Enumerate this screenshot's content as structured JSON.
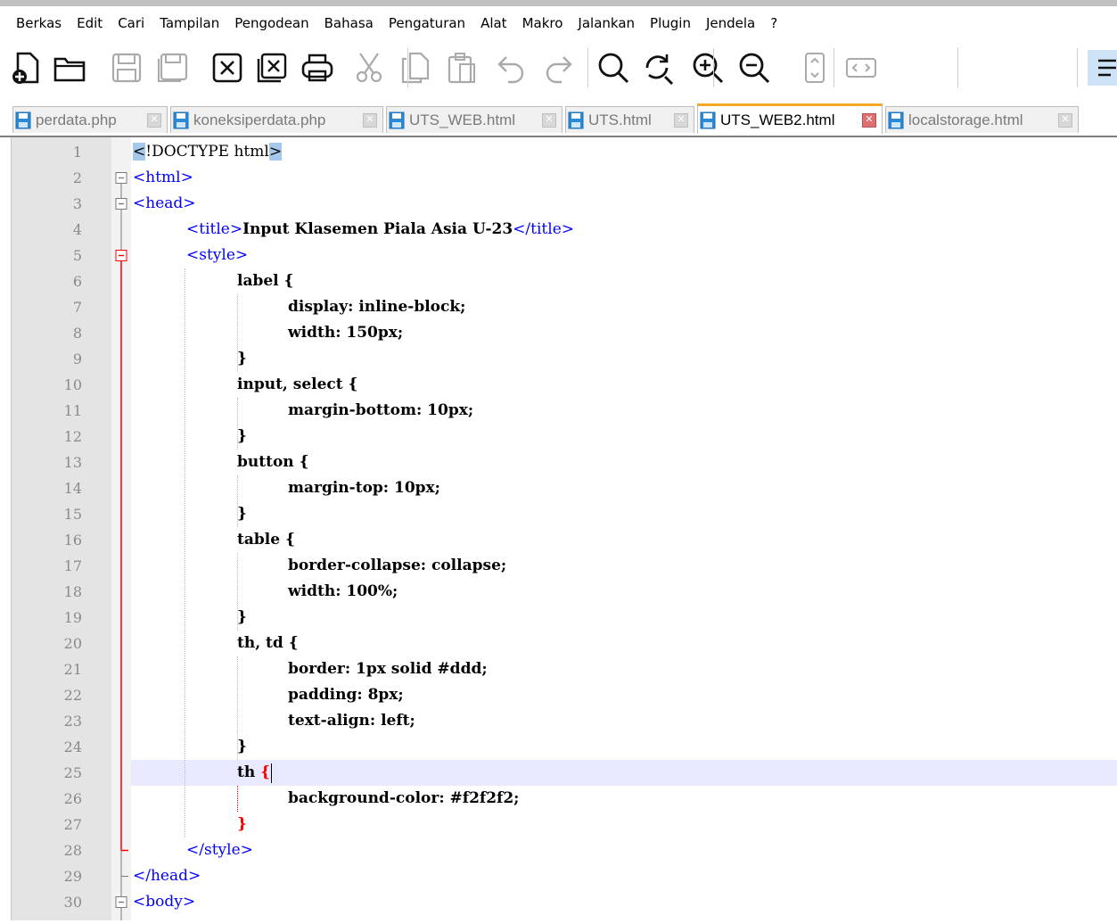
{
  "menu": [
    "Berkas",
    "Edit",
    "Cari",
    "Tampilan",
    "Pengodean",
    "Bahasa",
    "Pengaturan",
    "Alat",
    "Makro",
    "Jalankan",
    "Plugin",
    "Jendela",
    "?"
  ],
  "toolbar": [
    {
      "name": "new-file-icon"
    },
    {
      "name": "open-folder-icon"
    },
    {
      "name": "save-icon"
    },
    {
      "name": "save-all-icon"
    },
    {
      "name": "close-file-icon"
    },
    {
      "name": "close-all-icon"
    },
    {
      "name": "print-icon"
    },
    {
      "name": "cut-icon"
    },
    {
      "name": "copy-icon"
    },
    {
      "name": "paste-icon"
    },
    {
      "name": "undo-icon"
    },
    {
      "name": "redo-icon"
    },
    {
      "name": "find-icon"
    },
    {
      "name": "replace-icon"
    },
    {
      "name": "zoom-in-icon"
    },
    {
      "name": "zoom-out-icon"
    },
    {
      "name": "sync-vertical-icon"
    },
    {
      "name": "sync-horizontal-icon"
    },
    {
      "name": "word-wrap-icon"
    }
  ],
  "tabs": [
    {
      "label": "perdata.php",
      "active": false
    },
    {
      "label": "koneksiperdata.php",
      "active": false
    },
    {
      "label": "UTS_WEB.html",
      "active": false
    },
    {
      "label": "UTS.html",
      "active": false
    },
    {
      "label": "UTS_WEB2.html",
      "active": true
    },
    {
      "label": "localstorage.html",
      "active": false
    }
  ],
  "editor": {
    "current_line": 25,
    "lines": [
      {
        "n": "1",
        "indent": 0,
        "parts": [
          [
            "hl",
            "<"
          ],
          [
            "doc",
            "!DOCTYPE html"
          ],
          [
            "hl",
            ">"
          ]
        ]
      },
      {
        "n": "2",
        "indent": 0,
        "parts": [
          [
            "tag",
            "<html>"
          ]
        ]
      },
      {
        "n": "3",
        "indent": 0,
        "parts": [
          [
            "tag",
            "<head>"
          ]
        ]
      },
      {
        "n": "4",
        "indent": 1,
        "parts": [
          [
            "tag",
            "<title>"
          ],
          [
            "b",
            "Input Klasemen Piala Asia U-23"
          ],
          [
            "tag",
            "</title>"
          ]
        ]
      },
      {
        "n": "5",
        "indent": 1,
        "parts": [
          [
            "tag",
            "<style>"
          ]
        ]
      },
      {
        "n": "6",
        "indent": 2,
        "parts": [
          [
            "b",
            "label {"
          ]
        ]
      },
      {
        "n": "7",
        "indent": 3,
        "parts": [
          [
            "b",
            "display: inline-block;"
          ]
        ]
      },
      {
        "n": "8",
        "indent": 3,
        "parts": [
          [
            "b",
            "width: 150px;"
          ]
        ]
      },
      {
        "n": "9",
        "indent": 2,
        "parts": [
          [
            "b",
            "}"
          ]
        ]
      },
      {
        "n": "10",
        "indent": 2,
        "parts": [
          [
            "b",
            "input, select {"
          ]
        ]
      },
      {
        "n": "11",
        "indent": 3,
        "parts": [
          [
            "b",
            "margin-bottom: 10px;"
          ]
        ]
      },
      {
        "n": "12",
        "indent": 2,
        "parts": [
          [
            "b",
            "}"
          ]
        ]
      },
      {
        "n": "13",
        "indent": 2,
        "parts": [
          [
            "b",
            "button {"
          ]
        ]
      },
      {
        "n": "14",
        "indent": 3,
        "parts": [
          [
            "b",
            "margin-top: 10px;"
          ]
        ]
      },
      {
        "n": "15",
        "indent": 2,
        "parts": [
          [
            "b",
            "}"
          ]
        ]
      },
      {
        "n": "16",
        "indent": 2,
        "parts": [
          [
            "b",
            "table {"
          ]
        ]
      },
      {
        "n": "17",
        "indent": 3,
        "parts": [
          [
            "b",
            "border-collapse: collapse;"
          ]
        ]
      },
      {
        "n": "18",
        "indent": 3,
        "parts": [
          [
            "b",
            "width: 100%;"
          ]
        ]
      },
      {
        "n": "19",
        "indent": 2,
        "parts": [
          [
            "b",
            "}"
          ]
        ]
      },
      {
        "n": "20",
        "indent": 2,
        "parts": [
          [
            "b",
            "th, td {"
          ]
        ]
      },
      {
        "n": "21",
        "indent": 3,
        "parts": [
          [
            "b",
            "border: 1px solid #ddd;"
          ]
        ]
      },
      {
        "n": "22",
        "indent": 3,
        "parts": [
          [
            "b",
            "padding: 8px;"
          ]
        ]
      },
      {
        "n": "23",
        "indent": 3,
        "parts": [
          [
            "b",
            "text-align: left;"
          ]
        ]
      },
      {
        "n": "24",
        "indent": 2,
        "parts": [
          [
            "b",
            "}"
          ]
        ]
      },
      {
        "n": "25",
        "indent": 2,
        "parts": [
          [
            "b",
            "th "
          ],
          [
            "red",
            "{"
          ],
          [
            "caret",
            ""
          ]
        ]
      },
      {
        "n": "26",
        "indent": 3,
        "parts": [
          [
            "b",
            "background-color: #f2f2f2;"
          ]
        ]
      },
      {
        "n": "27",
        "indent": 2,
        "parts": [
          [
            "red",
            "}"
          ]
        ]
      },
      {
        "n": "28",
        "indent": 1,
        "parts": [
          [
            "tag",
            "</style>"
          ]
        ]
      },
      {
        "n": "29",
        "indent": 0,
        "parts": [
          [
            "tag",
            "</head>"
          ]
        ]
      },
      {
        "n": "30",
        "indent": 0,
        "parts": [
          [
            "tag",
            "<body>"
          ]
        ]
      }
    ]
  },
  "colors": {
    "tag": "#0000ff",
    "fold_marker_active": "#ff0000",
    "active_tab_accent": "#f5a623",
    "current_line_bg": "#e8e8ff"
  }
}
